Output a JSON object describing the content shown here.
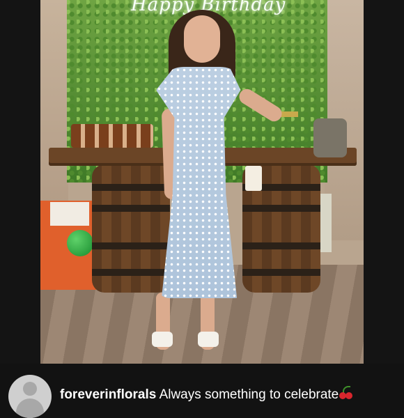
{
  "post": {
    "neon_sign_text": "Happy Birthday",
    "caption_username": "foreverinflorals",
    "caption_text": "Always something to celebrate",
    "caption_emoji_icon": "cherry-icon"
  },
  "colors": {
    "background": "#121212",
    "caption_text": "#ffffff",
    "avatar_placeholder": "#cfcfcf"
  }
}
